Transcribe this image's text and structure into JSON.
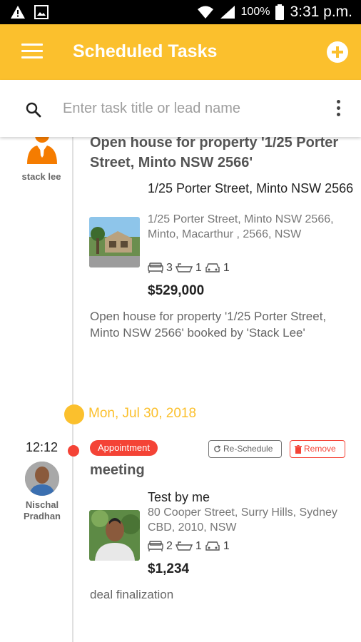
{
  "status_bar": {
    "battery": "100%",
    "time": "3:31 p.m."
  },
  "app_bar": {
    "title": "Scheduled Tasks"
  },
  "search": {
    "placeholder": "Enter task title or lead name"
  },
  "tasks": [
    {
      "person": "stack lee",
      "title": "Open house for property '1/25 Porter Street, Minto NSW 2566'",
      "property_title": "1/25 Porter Street, Minto NSW 2566",
      "address": "1/25 Porter Street, Minto NSW 2566, Minto, Macarthur , 2566, NSW",
      "beds": "3",
      "baths": "1",
      "cars": "1",
      "price": "$529,000",
      "description": "Open house for property '1/25 Porter Street, Minto NSW 2566' booked by 'Stack Lee'"
    },
    {
      "time": "12:12",
      "person": "Nischal Pradhan",
      "badge": "Appointment",
      "reschedule_label": "Re-Schedule",
      "remove_label": "Remove",
      "title": "meeting",
      "property_title": "Test by me",
      "address": "80 Cooper Street, Surry Hills, Sydney CBD, 2010, NSW",
      "beds": "2",
      "baths": "1",
      "cars": "1",
      "price": "$1,234",
      "description": "deal finalization"
    }
  ],
  "date_group": {
    "label": "Mon, Jul 30, 2018"
  },
  "colors": {
    "accent": "#fbc02d",
    "alert": "#f44336",
    "avatar_orange": "#f57c00"
  },
  "icons": [
    "menu-icon",
    "add-icon",
    "search-icon",
    "more-vert-icon",
    "person-icon",
    "bed-icon",
    "bath-icon",
    "car-icon",
    "refresh-icon",
    "trash-icon"
  ]
}
